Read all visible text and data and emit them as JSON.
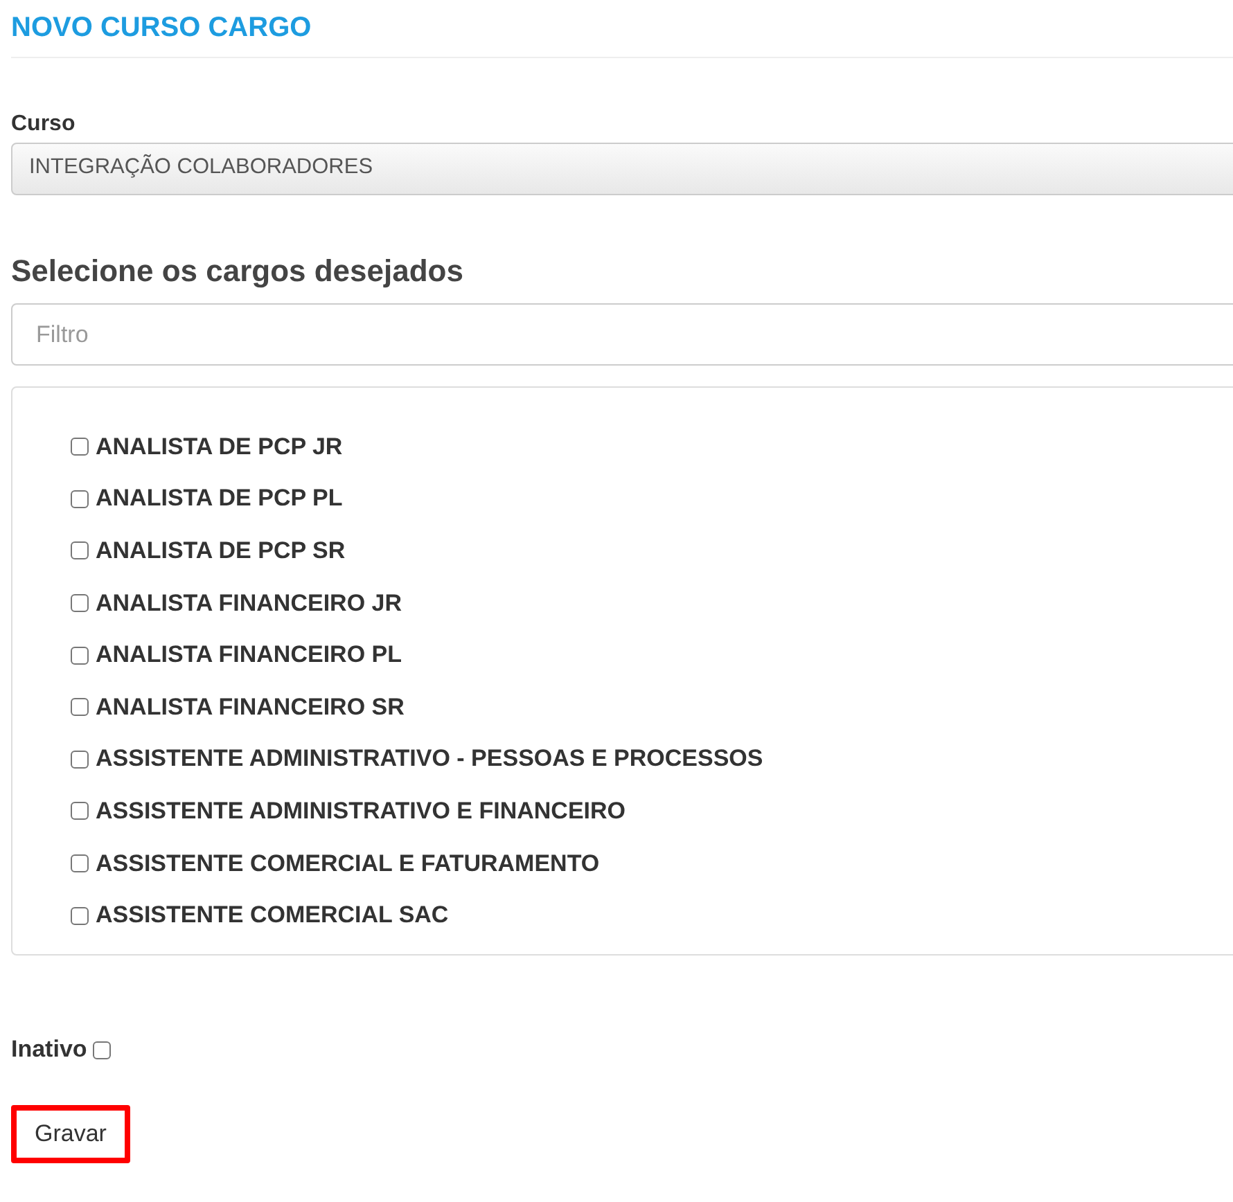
{
  "page": {
    "title": "NOVO CURSO CARGO"
  },
  "course": {
    "label": "Curso",
    "value": "INTEGRAÇÃO COLABORADORES"
  },
  "positions": {
    "heading": "Selecione os cargos desejados",
    "filter": {
      "placeholder": "Filtro"
    },
    "items": [
      {
        "label": "ANALISTA DE PCP JR",
        "checked": false
      },
      {
        "label": "ANALISTA DE PCP PL",
        "checked": false
      },
      {
        "label": "ANALISTA DE PCP SR",
        "checked": false
      },
      {
        "label": "ANALISTA FINANCEIRO JR",
        "checked": false
      },
      {
        "label": "ANALISTA FINANCEIRO PL",
        "checked": false
      },
      {
        "label": "ANALISTA FINANCEIRO SR",
        "checked": false
      },
      {
        "label": "ASSISTENTE ADMINISTRATIVO - PESSOAS E PROCESSOS",
        "checked": false
      },
      {
        "label": "ASSISTENTE ADMINISTRATIVO E FINANCEIRO",
        "checked": false
      },
      {
        "label": "ASSISTENTE COMERCIAL E FATURAMENTO",
        "checked": false
      },
      {
        "label": "ASSISTENTE COMERCIAL SAC",
        "checked": false
      }
    ]
  },
  "inactive": {
    "label": "Inativo",
    "checked": false
  },
  "save_button": {
    "label": "Gravar",
    "highlighted": true
  }
}
